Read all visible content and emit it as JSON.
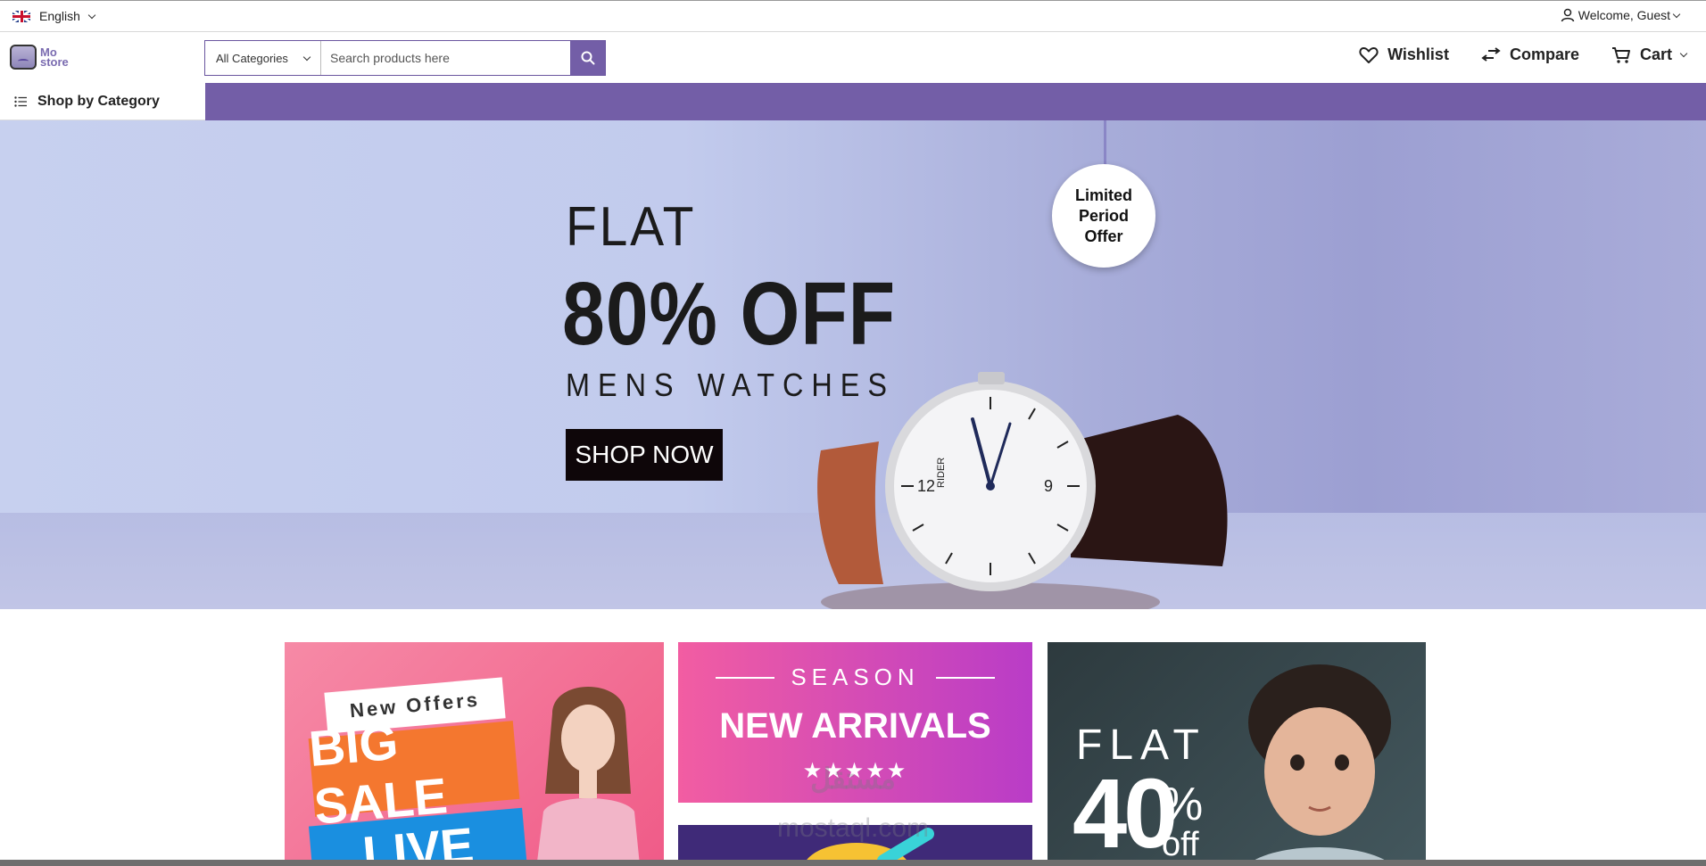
{
  "topbar": {
    "language": "English",
    "welcome": "Welcome, Guest"
  },
  "header": {
    "logo_line1": "Mo",
    "logo_line2": "store",
    "category_select": "All Categories",
    "search_placeholder": "Search products here",
    "nav": {
      "wishlist": "Wishlist",
      "compare": "Compare",
      "cart": "Cart"
    }
  },
  "category_bar": {
    "shop_by_category": "Shop by Category"
  },
  "hero": {
    "line1": "FLAT",
    "line2": "80% OFF",
    "line3": "MENS WATCHES",
    "button": "SHOP NOW",
    "tag": "Limited Period Offer",
    "watch_brand": "RIDER"
  },
  "promos": {
    "p1_top": "New Offers",
    "p1_main": "BIG SALE",
    "p1_bottom": "LIVE",
    "p2_top": "SEASON",
    "p2_main": "NEW ARRIVALS",
    "p2_stars": "★★★★★",
    "p3_flat": "FLAT",
    "p3_number": "40",
    "p3_pct": "%",
    "p3_off": "off"
  },
  "watermark": {
    "arabic": "مستقل",
    "latin": "mostaql.com"
  },
  "colors": {
    "brand": "#735ea7",
    "hero_bg": "#c2cbed",
    "button_dark": "#0e0609"
  }
}
